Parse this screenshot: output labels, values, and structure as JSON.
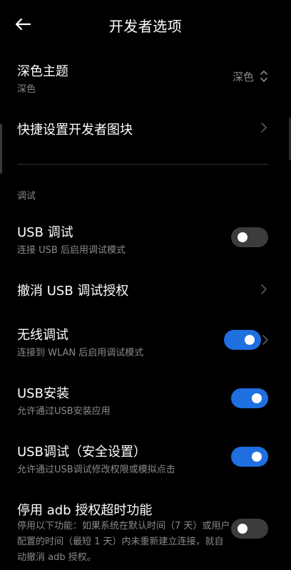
{
  "header": {
    "title": "开发者选项"
  },
  "dark_theme": {
    "title": "深色主题",
    "subtitle": "深色",
    "value": "深色"
  },
  "quick_tiles": {
    "title": "快捷设置开发者图块"
  },
  "debug_section": {
    "header": "调试"
  },
  "usb_debugging": {
    "title": "USB 调试",
    "subtitle": "连接 USB 后启用调试模式",
    "enabled": false
  },
  "revoke_usb_auth": {
    "title": "撤消 USB 调试授权"
  },
  "wireless_debugging": {
    "title": "无线调试",
    "subtitle": "连接到 WLAN 后启用调试模式",
    "enabled": true
  },
  "usb_install": {
    "title": "USB安装",
    "subtitle": "允许通过USB安装应用",
    "enabled": true
  },
  "usb_debug_security": {
    "title": "USB调试（安全设置）",
    "subtitle": "允许通过USB调试修改权限或模拟点击",
    "enabled": true
  },
  "adb_timeout": {
    "title": "停用 adb 授权超时功能",
    "subtitle": "停用以下功能：如果系统在默认时间（7 天）或用户配置的时间（最短 1 天）内未重新建立连接，就自动撤消 adb 授权。",
    "enabled": false
  },
  "colors": {
    "background": "#000000",
    "toggle_on": "#1e6fe0",
    "toggle_off": "#3c3c3c",
    "secondary_text": "#8a8a8a"
  }
}
